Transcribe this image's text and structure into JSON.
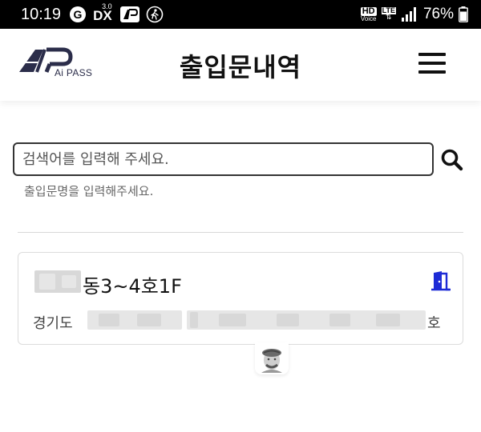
{
  "status_bar": {
    "time": "10:19",
    "battery": "76%",
    "icons": [
      "g-icon",
      "dx-3.0-icon",
      "ap-icon",
      "walk-icon",
      "hd-voice-icon",
      "lte-icon",
      "signal-icon",
      "battery-icon"
    ],
    "hd_label": "HD",
    "voice_label": "Voice",
    "lte_label": "LTE",
    "dx_superscript": "3.0",
    "dx_label": "DX"
  },
  "header": {
    "logo_text": "Ai PASS",
    "title": "출입문내역",
    "menu_icon": "hamburger-menu-icon"
  },
  "search": {
    "placeholder": "검색어를 입력해 주세요.",
    "value": "",
    "hint": "출입문명을 입력해주세요.",
    "icon": "search-icon"
  },
  "entries": [
    {
      "title": "동3~4호1F",
      "address_prefix": "경기도",
      "address_suffix": "호",
      "icon": "door-icon",
      "icon_color": "#1d2bd6"
    }
  ],
  "colors": {
    "status_bar_bg": "#000000",
    "accent_blue": "#1d2bd6",
    "logo_navy": "#2b2d4a"
  }
}
